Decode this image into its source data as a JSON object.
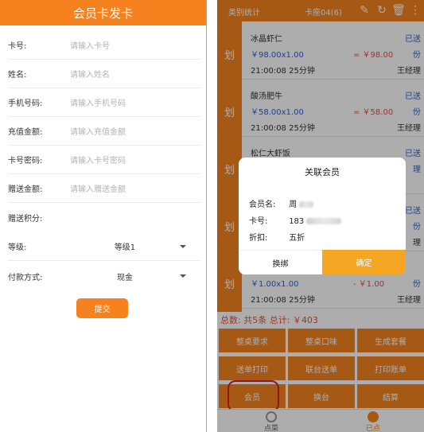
{
  "left": {
    "title": "会员卡发卡",
    "fields": [
      {
        "label": "卡号:",
        "placeholder": "请输入卡号"
      },
      {
        "label": "姓名:",
        "placeholder": "请输入姓名"
      },
      {
        "label": "手机号码:",
        "placeholder": "请输入手机号码"
      },
      {
        "label": "充值金额:",
        "placeholder": "请输入充值金额"
      },
      {
        "label": "卡号密码:",
        "placeholder": "请输入卡号密码"
      },
      {
        "label": "赠送金额:",
        "placeholder": "请输入赠送金额"
      },
      {
        "label": "赠送积分:",
        "placeholder": ""
      }
    ],
    "level": {
      "label": "等级:",
      "value": "等级1"
    },
    "payment": {
      "label": "付款方式:",
      "value": "现金"
    },
    "submit": "提交"
  },
  "right": {
    "top_title": "类别统计",
    "table_label": "卡座04(6)",
    "side_tab": "划",
    "items": [
      {
        "name": "冰晶虾仁",
        "status": "已送",
        "price_qty": "￥98.00x1.00",
        "total": "= ￥98.00",
        "unit": "份",
        "time": "21:00:08  25分钟",
        "waiter": "王经理"
      },
      {
        "name": "酸汤肥牛",
        "status": "已送",
        "price_qty": "￥58.00x1.00",
        "total": "= ￥58.00",
        "unit": "份",
        "time": "21:00:08  25分钟",
        "waiter": "王经理"
      },
      {
        "name": "松仁大虾饭",
        "status": "已送",
        "price_qty": "",
        "total": "",
        "unit": "理",
        "time": "",
        "waiter": ""
      },
      {
        "name": "",
        "status": "已送",
        "price_qty": "",
        "total": "",
        "unit": "份",
        "time": "",
        "waiter": "理"
      },
      {
        "name": "",
        "status": "",
        "price_qty": "￥1.00x1.00",
        "total": "- ￥1.00",
        "unit": "份",
        "time": "21:00:08  25分钟",
        "waiter": "王经理"
      }
    ],
    "summary": "总数: 共5条 总计: ￥403",
    "actions": [
      "整桌要求",
      "整桌口味",
      "生成套餐",
      "送单打印",
      "联台送单",
      "打印账单",
      "会员",
      "换台",
      "结算"
    ],
    "nav": [
      {
        "label": "点菜"
      },
      {
        "label": "已点"
      }
    ],
    "dialog": {
      "title": "关联会员",
      "member_label": "会员名:",
      "member_value": "周",
      "card_label": "卡号:",
      "card_value": "183",
      "discount_label": "折扣:",
      "discount_value": "五折",
      "switch": "换绑",
      "confirm": "确定"
    }
  },
  "colors": {
    "accent": "#f5821f",
    "confirm": "#f5a623",
    "link": "#2b5fd9",
    "price": "#e74c3c",
    "highlight": "#e02020"
  }
}
